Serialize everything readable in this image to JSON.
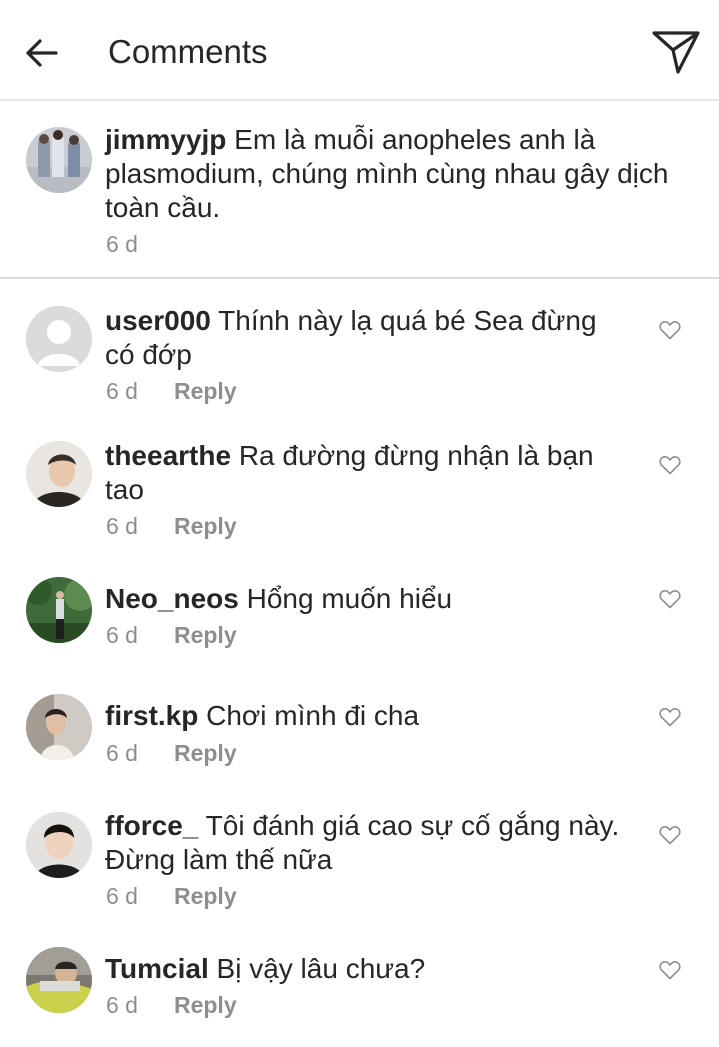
{
  "header": {
    "title": "Comments"
  },
  "caption": {
    "username": "jimmyyjp",
    "text": "Em là muỗi anopheles anh là plasmodium, chúng mình cùng nhau gây dịch toàn cầu.",
    "time": "6 d"
  },
  "comments": [
    {
      "username": "user000",
      "text": "Thính này lạ quá bé Sea đừng có đớp",
      "time": "6 d",
      "reply_label": "Reply"
    },
    {
      "username": "theearthe",
      "text": "Ra đường đừng nhận là bạn tao",
      "time": "6 d",
      "reply_label": "Reply"
    },
    {
      "username": "Neo_neos",
      "text": "Hổng muốn hiểu",
      "time": "6 d",
      "reply_label": "Reply"
    },
    {
      "username": "first.kp",
      "text": "Chơi mình đi cha",
      "time": "6 d",
      "reply_label": "Reply"
    },
    {
      "username": "fforce_",
      "text": "Tôi đánh giá cao sự cố gắng này. Đừng làm thế nữa",
      "time": "6 d",
      "reply_label": "Reply"
    },
    {
      "username": "Tumcial",
      "text": "Bị vậy lâu chưa?",
      "time": "6 d",
      "reply_label": "Reply"
    }
  ],
  "colors": {
    "text": "#262626",
    "secondary": "#8e8e8e",
    "divider": "#dbdbdb"
  },
  "icons": {
    "back": "arrow-left-icon",
    "send": "paper-plane-icon",
    "like": "heart-outline-icon"
  }
}
